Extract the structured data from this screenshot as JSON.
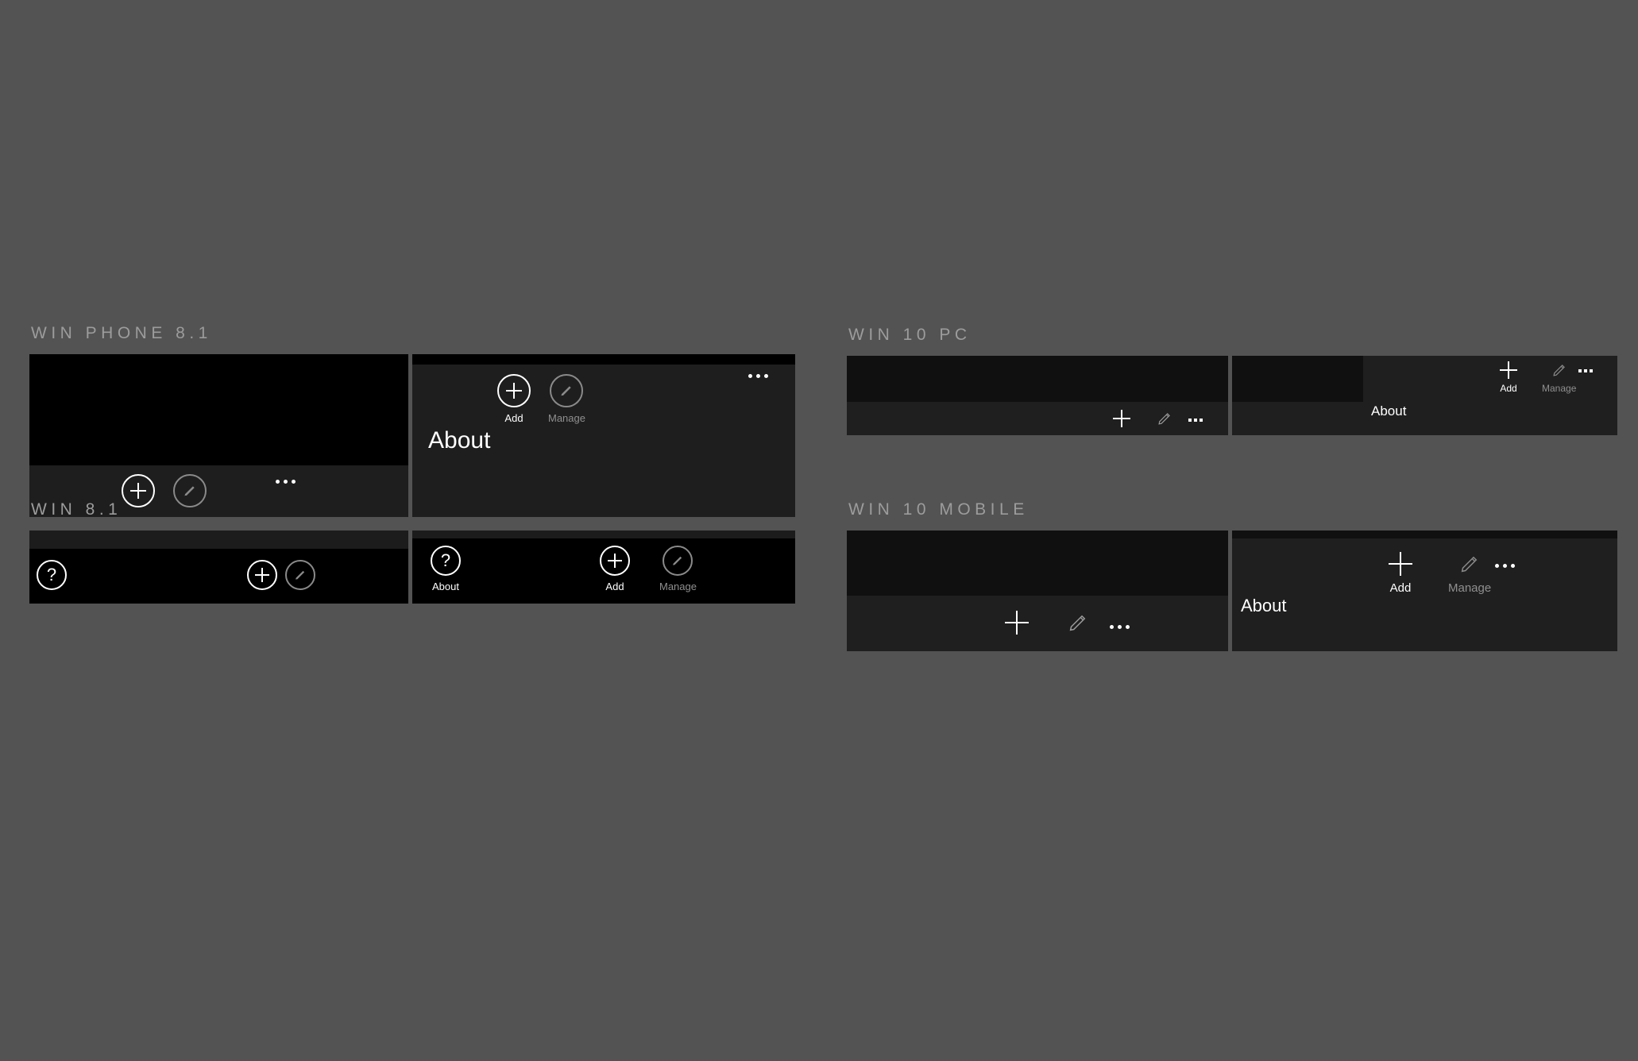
{
  "background_color": "#535353",
  "sections": {
    "win_phone_81": {
      "title": "WIN PHONE 8.1",
      "collapsed": {
        "add_icon": "plus-circle-icon",
        "manage_icon": "pencil-circle-icon",
        "overflow_icon": "ellipsis-icon"
      },
      "expanded": {
        "add_icon": "plus-circle-icon",
        "add_label": "Add",
        "manage_icon": "pencil-circle-icon",
        "manage_label": "Manage",
        "overflow_icon": "ellipsis-icon",
        "about_label": "About"
      }
    },
    "win_81": {
      "title": "WIN 8.1",
      "collapsed": {
        "about_icon": "question-circle-icon",
        "add_icon": "plus-circle-icon",
        "manage_icon": "pencil-circle-icon"
      },
      "expanded": {
        "about_icon": "question-circle-icon",
        "about_label": "About",
        "add_icon": "plus-circle-icon",
        "add_label": "Add",
        "manage_icon": "pencil-circle-icon",
        "manage_label": "Manage"
      }
    },
    "win_10_pc": {
      "title": "WIN 10 PC",
      "collapsed": {
        "add_icon": "plus-icon",
        "manage_icon": "pencil-icon",
        "overflow_icon": "ellipsis-icon"
      },
      "expanded": {
        "add_icon": "plus-icon",
        "add_label": "Add",
        "manage_icon": "pencil-icon",
        "manage_label": "Manage",
        "overflow_icon": "ellipsis-icon",
        "about_label": "About"
      }
    },
    "win_10_mobile": {
      "title": "WIN 10 MOBILE",
      "collapsed": {
        "add_icon": "plus-icon",
        "manage_icon": "pencil-icon",
        "overflow_icon": "ellipsis-icon"
      },
      "expanded": {
        "add_icon": "plus-icon",
        "add_label": "Add",
        "manage_icon": "pencil-icon",
        "manage_label": "Manage",
        "overflow_icon": "ellipsis-icon",
        "about_label": "About"
      }
    }
  },
  "colors": {
    "title_text": "#9c9c9c",
    "enabled_text": "#ffffff",
    "disabled_text": "#8f8f8f",
    "panel_dark": "#000000",
    "panel_chrome": "#1e1e1e",
    "panel_w10": "#1f1f1f"
  }
}
